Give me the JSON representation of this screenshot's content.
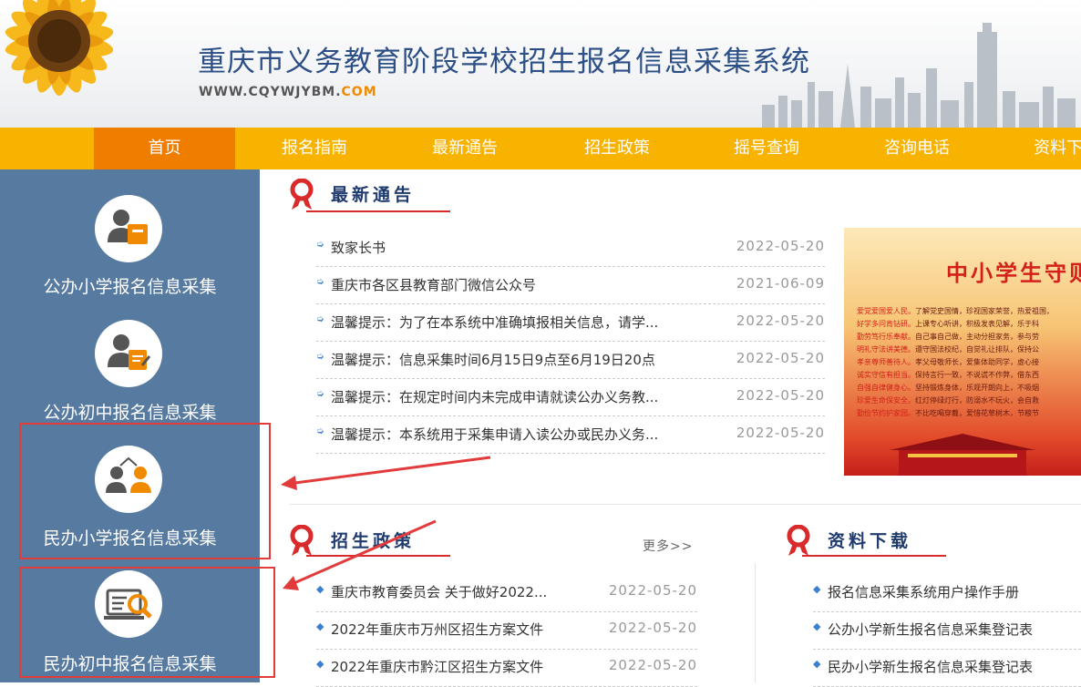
{
  "header": {
    "title": "重庆市义务教育阶段学校招生报名信息采集系统",
    "url_prefix": "WWW.CQYWJYBM.",
    "url_suffix": "COM"
  },
  "nav": {
    "items": [
      {
        "label": "首页",
        "active": true
      },
      {
        "label": "报名指南"
      },
      {
        "label": "最新通告"
      },
      {
        "label": "招生政策"
      },
      {
        "label": "摇号查询"
      },
      {
        "label": "咨询电话"
      },
      {
        "label": "资料下"
      }
    ]
  },
  "sidebar": {
    "items": [
      {
        "label": "公办小学报名信息采集",
        "icon": "public-primary-icon"
      },
      {
        "label": "公办初中报名信息采集",
        "icon": "public-junior-icon"
      },
      {
        "label": "民办小学报名信息采集",
        "icon": "private-primary-icon"
      },
      {
        "label": "民办初中报名信息采集",
        "icon": "private-junior-icon"
      }
    ]
  },
  "notices": {
    "title": "最新通告",
    "items": [
      {
        "text": "致家长书",
        "date": "2022-05-20"
      },
      {
        "text": "重庆市各区县教育部门微信公众号",
        "date": "2021-06-09"
      },
      {
        "text": "温馨提示：为了在本系统中准确填报相关信息，请学...",
        "date": "2022-05-20"
      },
      {
        "text": "温馨提示：信息采集时间6月15日9点至6月19日20点",
        "date": "2022-05-20"
      },
      {
        "text": "温馨提示：在规定时间内未完成申请就读公办义务教...",
        "date": "2022-05-20"
      },
      {
        "text": "温馨提示：本系统用于采集申请入读公办或民办义务...",
        "date": "2022-05-20"
      }
    ]
  },
  "banner": {
    "title": "中小学生守则",
    "lines": [
      {
        "lead": "爱党爱国爱人民。",
        "text": "了解党史国情，珍视国家荣誉，热爱祖国，"
      },
      {
        "lead": "好学多问肯钻研。",
        "text": "上课专心听讲，积极发表见解，乐于科"
      },
      {
        "lead": "勤劳笃行乐奉献。",
        "text": "自己事自己做，主动分担家务，参与劳"
      },
      {
        "lead": "明礼守法讲美德。",
        "text": "遵守国法校纪，自觉礼让排队，保持公"
      },
      {
        "lead": "孝亲尊师善待人。",
        "text": "孝父母敬师长，爱集体助同学，虚心接"
      },
      {
        "lead": "诚实守信有担当。",
        "text": "保持言行一致，不说谎不作弊，借东西"
      },
      {
        "lead": "自强自律健身心。",
        "text": "坚持锻炼身体，乐观开朗向上，不吸烟"
      },
      {
        "lead": "珍爱生命保安全。",
        "text": "红灯停绿灯行，防溺水不玩火，会自救"
      },
      {
        "lead": "勤俭节约护家园。",
        "text": "不比吃喝穿戴，爱惜花草树木，节粮节"
      }
    ]
  },
  "policy": {
    "title": "招生政策",
    "more": "更多>>",
    "items": [
      {
        "text": "重庆市教育委员会 关于做好2022...",
        "date": "2022-05-20"
      },
      {
        "text": "2022年重庆市万州区招生方案文件",
        "date": "2022-05-20"
      },
      {
        "text": "2022年重庆市黔江区招生方案文件",
        "date": "2022-05-20"
      }
    ]
  },
  "downloads": {
    "title": "资料下载",
    "items": [
      {
        "text": "报名信息采集系统用户操作手册"
      },
      {
        "text": "公办小学新生报名信息采集登记表"
      },
      {
        "text": "民办小学新生报名信息采集登记表"
      }
    ]
  },
  "colors": {
    "nav_bg": "#f8b300",
    "nav_active": "#ef7d00",
    "sidebar_bg": "#577aa0",
    "title_blue": "#2b4f86",
    "accent_red": "#d92b2b",
    "highlight_box": "#e23b3b"
  }
}
